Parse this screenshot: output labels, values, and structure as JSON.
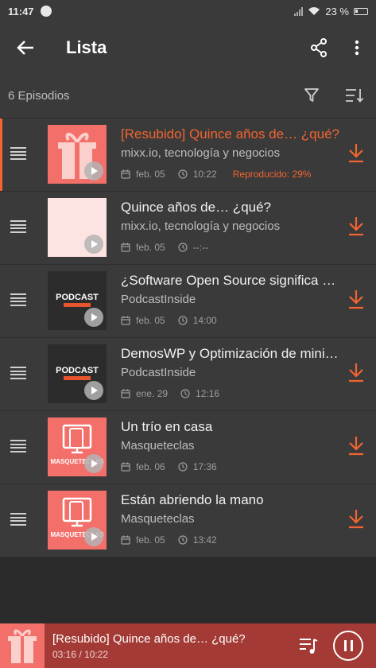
{
  "status": {
    "time": "11:47",
    "battery": "23 %"
  },
  "appbar": {
    "title": "Lista",
    "back_icon": "arrow-left-icon",
    "share_icon": "share-icon",
    "menu_icon": "more-vert-icon"
  },
  "subbar": {
    "count": "6 Episodios",
    "filter_icon": "filter-icon",
    "sort_icon": "sort-icon"
  },
  "colors": {
    "accent": "#f26430",
    "row_bg": "#3a3a3a",
    "page_bg": "#2b2b2b",
    "player_bg": "#a33a35"
  },
  "episodes": [
    {
      "title": "[Resubido] Quince años de… ¿qué?",
      "feed": "mixx.io, tecnología y negocios",
      "date": "feb. 05",
      "duration": "10:22",
      "played": "Reproducido: 29%",
      "thumb": "mixx"
    },
    {
      "title": "Quince años de… ¿qué?",
      "feed": "mixx.io, tecnología y negocios",
      "date": "feb. 05",
      "duration": "--:--",
      "played": "",
      "thumb": "blank"
    },
    {
      "title": "¿Software Open Source significa gratis?",
      "feed": "PodcastInside",
      "date": "feb. 05",
      "duration": "14:00",
      "played": "",
      "thumb": "podcast"
    },
    {
      "title": "DemosWP y Optimización de miniaturas",
      "feed": "PodcastInside",
      "date": "ene. 29",
      "duration": "12:16",
      "played": "",
      "thumb": "podcast"
    },
    {
      "title": "Un trío en casa",
      "feed": "Masqueteclas",
      "date": "feb. 06",
      "duration": "17:36",
      "played": "",
      "thumb": "masq"
    },
    {
      "title": "Están abriendo la mano",
      "feed": "Masqueteclas",
      "date": "feb. 05",
      "duration": "13:42",
      "played": "",
      "thumb": "masq"
    }
  ],
  "thumbs": {
    "podcast_label": "PODCAST",
    "masq_label": "MASQUETECLAS"
  },
  "player": {
    "title": "[Resubido] Quince años de… ¿qué?",
    "time": "03:16 / 10:22"
  }
}
